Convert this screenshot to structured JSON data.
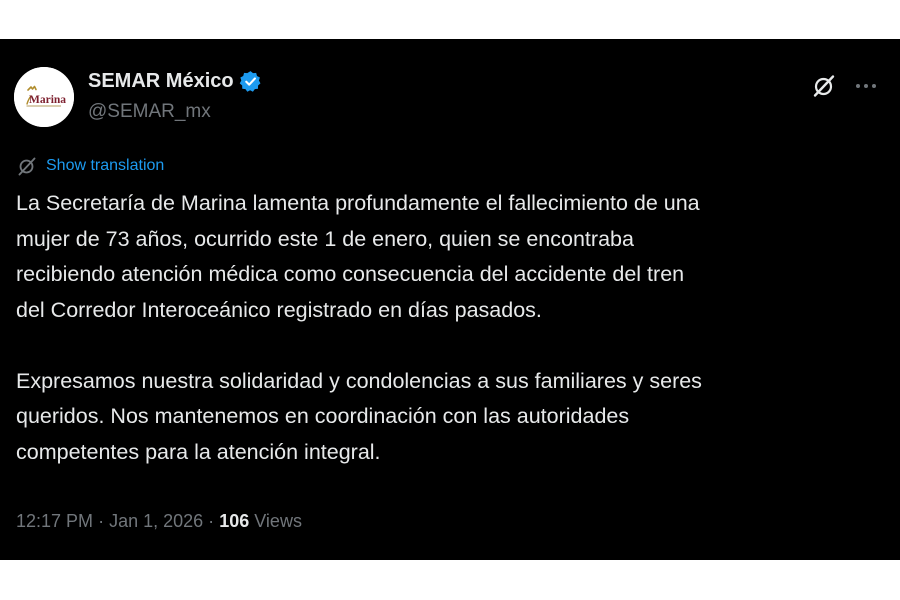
{
  "tweet": {
    "author": {
      "display_name": "SEMAR México",
      "handle": "@SEMAR_mx",
      "verified": true,
      "avatar_text": "Marina",
      "avatar_icon": "semar-logo-icon"
    },
    "translate_label": "Show translation",
    "paragraphs": [
      [
        "La Secretaría de Marina lamenta profundamente el fallecimiento de una",
        "mujer de 73 años, ocurrido este 1 de enero, quien se encontraba",
        "recibiendo atención médica como consecuencia del accidente del tren",
        "del Corredor Interoceánico registrado en días pasados."
      ],
      [
        "Expresamos nuestra solidaridad y condolencias a sus familiares y seres",
        "queridos. Nos mantenemos en coordinación con las autoridades",
        "competentes para la atención integral."
      ]
    ],
    "time": "12:17 PM",
    "date": "Jan 1, 2026",
    "separator": "·",
    "views_count": "106",
    "views_label": "Views"
  },
  "icons": {
    "verified": "verified-badge-icon",
    "grok": "grok-icon",
    "more": "more-options-icon",
    "translate": "translate-icon"
  },
  "colors": {
    "background": "#000000",
    "text": "#e7e9ea",
    "secondary_text": "#71767b",
    "link": "#1d9bf0",
    "verified": "#1d9bf0"
  }
}
